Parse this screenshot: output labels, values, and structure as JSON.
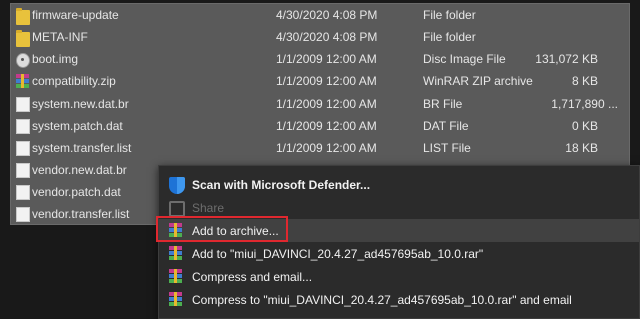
{
  "files": [
    {
      "name": "firmware-update",
      "date": "4/30/2020 4:08 PM",
      "type": "File folder",
      "size": "",
      "icon": "folder-icon"
    },
    {
      "name": "META-INF",
      "date": "4/30/2020 4:08 PM",
      "type": "File folder",
      "size": "",
      "icon": "folder-icon"
    },
    {
      "name": "boot.img",
      "date": "1/1/2009 12:00 AM",
      "type": "Disc Image File",
      "size": "131,072 KB",
      "icon": "disc-image-icon"
    },
    {
      "name": "compatibility.zip",
      "date": "1/1/2009 12:00 AM",
      "type": "WinRAR ZIP archive",
      "size": "8 KB",
      "icon": "winrar-icon"
    },
    {
      "name": "system.new.dat.br",
      "date": "1/1/2009 12:00 AM",
      "type": "BR File",
      "size": "1,717,890 ...",
      "icon": "file-icon"
    },
    {
      "name": "system.patch.dat",
      "date": "1/1/2009 12:00 AM",
      "type": "DAT File",
      "size": "0 KB",
      "icon": "file-icon"
    },
    {
      "name": "system.transfer.list",
      "date": "1/1/2009 12:00 AM",
      "type": "LIST File",
      "size": "18 KB",
      "icon": "file-icon"
    },
    {
      "name": "vendor.new.dat.br",
      "date": "",
      "type": "",
      "size": "",
      "icon": "file-icon"
    },
    {
      "name": "vendor.patch.dat",
      "date": "",
      "type": "",
      "size": "",
      "icon": "file-icon"
    },
    {
      "name": "vendor.transfer.list",
      "date": "",
      "type": "",
      "size": "",
      "icon": "file-icon"
    }
  ],
  "context_menu": {
    "items": [
      {
        "label": "Scan with Microsoft Defender...",
        "icon": "defender-shield-icon"
      },
      {
        "label": "Share",
        "icon": "share-icon"
      },
      {
        "label": "Add to archive...",
        "icon": "winrar-icon"
      },
      {
        "label": "Add to \"miui_DAVINCI_20.4.27_ad457695ab_10.0.rar\"",
        "icon": "winrar-icon"
      },
      {
        "label": "Compress and email...",
        "icon": "winrar-icon"
      },
      {
        "label": "Compress to \"miui_DAVINCI_20.4.27_ad457695ab_10.0.rar\" and email",
        "icon": "winrar-icon"
      }
    ]
  },
  "colors": {
    "highlight_border": "#e0282f",
    "selection_bg": "#5a5a5a",
    "menu_bg": "#2b2b2b"
  }
}
